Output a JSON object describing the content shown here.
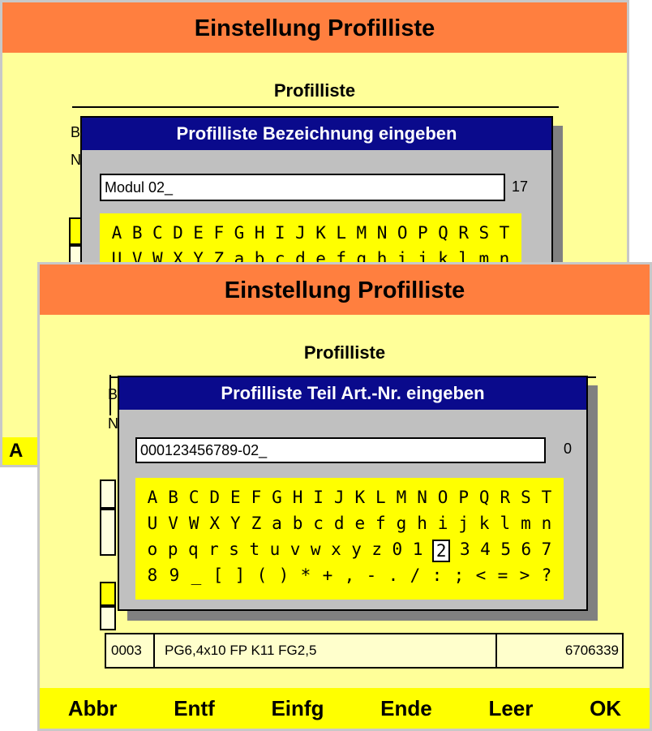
{
  "back_screen": {
    "title": "Einstellung Profilliste",
    "subtitle": "Profilliste",
    "dialog": {
      "title": "Profilliste Bezeichnung eingeben",
      "input_value": "Modul 02_",
      "remaining": "17",
      "keyboard_rows": [
        [
          "A",
          "B",
          "C",
          "D",
          "E",
          "F",
          "G",
          "H",
          "I",
          "J",
          "K",
          "L",
          "M",
          "N",
          "O",
          "P",
          "Q",
          "R",
          "S",
          "T"
        ],
        [
          "U",
          "V",
          "W",
          "X",
          "Y",
          "Z",
          "a",
          "b",
          "c",
          "d",
          "e",
          "f",
          "g",
          "h",
          "i",
          "j",
          "k",
          "l",
          "m",
          "n"
        ]
      ]
    },
    "partial_labels": [
      "B",
      "N"
    ],
    "fkey_partial": "A"
  },
  "front_screen": {
    "title": "Einstellung Profilliste",
    "subtitle": "Profilliste",
    "dialog": {
      "title": "Profilliste Teil Art.-Nr. eingeben",
      "input_value": "000123456789-02_",
      "remaining": "0",
      "keyboard_rows": [
        [
          "A",
          "B",
          "C",
          "D",
          "E",
          "F",
          "G",
          "H",
          "I",
          "J",
          "K",
          "L",
          "M",
          "N",
          "O",
          "P",
          "Q",
          "R",
          "S",
          "T"
        ],
        [
          "U",
          "V",
          "W",
          "X",
          "Y",
          "Z",
          "a",
          "b",
          "c",
          "d",
          "e",
          "f",
          "g",
          "h",
          "i",
          "j",
          "k",
          "l",
          "m",
          "n"
        ],
        [
          "o",
          "p",
          "q",
          "r",
          "s",
          "t",
          "u",
          "v",
          "w",
          "x",
          "y",
          "z",
          "0",
          "1",
          "2",
          "3",
          "4",
          "5",
          "6",
          "7"
        ],
        [
          "8",
          "9",
          "_",
          "[",
          "]",
          "(",
          ")",
          "*",
          "+",
          ",",
          "-",
          ".",
          "/",
          ":",
          ";",
          "<",
          "=",
          ">",
          "?"
        ]
      ],
      "selected_key": "2"
    },
    "partial_labels": [
      "B",
      "N"
    ],
    "table_row": {
      "number": "0003",
      "description": "PG6,4x10 FP K11 FG2,5",
      "article": "6706339"
    },
    "function_keys": [
      "Abbr",
      "Entf",
      "Einfg",
      "Ende",
      "Leer",
      "OK"
    ]
  }
}
